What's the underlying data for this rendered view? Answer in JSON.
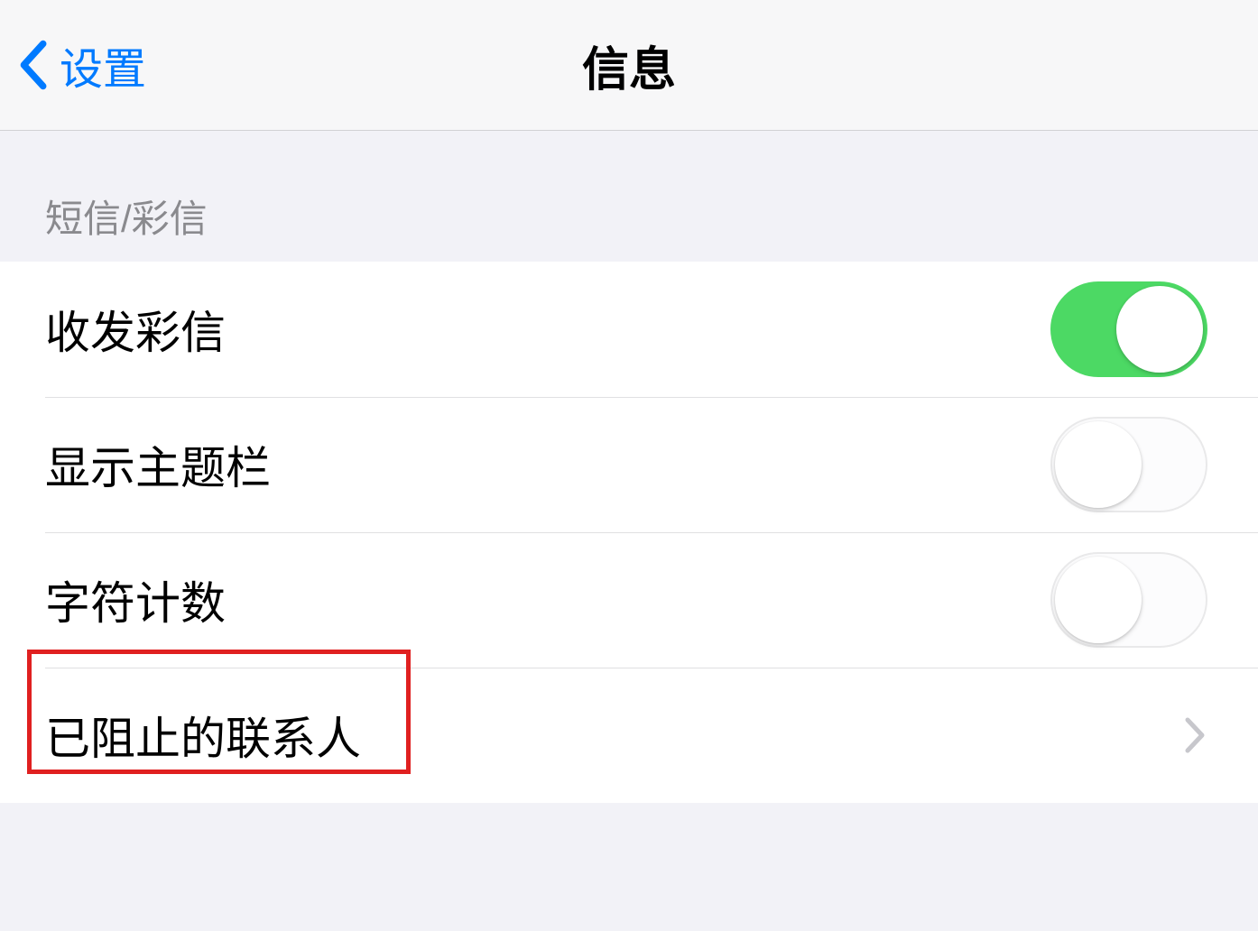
{
  "nav": {
    "back_label": "设置",
    "title": "信息"
  },
  "section": {
    "header": "短信/彩信"
  },
  "rows": {
    "mms": {
      "label": "收发彩信",
      "on": true
    },
    "subject": {
      "label": "显示主题栏",
      "on": false
    },
    "char_count": {
      "label": "字符计数",
      "on": false
    },
    "blocked": {
      "label": "已阻止的联系人"
    }
  }
}
